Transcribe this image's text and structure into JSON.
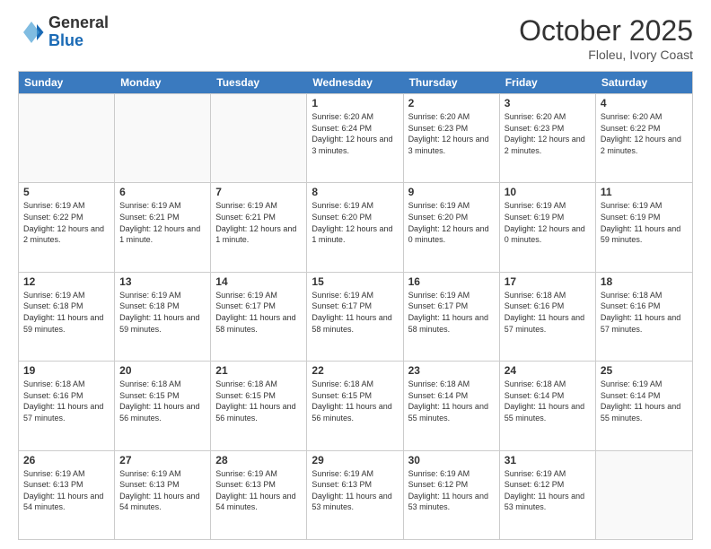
{
  "header": {
    "logo_general": "General",
    "logo_blue": "Blue",
    "month_title": "October 2025",
    "location": "Floleu, Ivory Coast"
  },
  "calendar": {
    "days_of_week": [
      "Sunday",
      "Monday",
      "Tuesday",
      "Wednesday",
      "Thursday",
      "Friday",
      "Saturday"
    ],
    "weeks": [
      [
        {
          "day": "",
          "info": "",
          "empty": true
        },
        {
          "day": "",
          "info": "",
          "empty": true
        },
        {
          "day": "",
          "info": "",
          "empty": true
        },
        {
          "day": "1",
          "info": "Sunrise: 6:20 AM\nSunset: 6:24 PM\nDaylight: 12 hours and 3 minutes."
        },
        {
          "day": "2",
          "info": "Sunrise: 6:20 AM\nSunset: 6:23 PM\nDaylight: 12 hours and 3 minutes."
        },
        {
          "day": "3",
          "info": "Sunrise: 6:20 AM\nSunset: 6:23 PM\nDaylight: 12 hours and 2 minutes."
        },
        {
          "day": "4",
          "info": "Sunrise: 6:20 AM\nSunset: 6:22 PM\nDaylight: 12 hours and 2 minutes."
        }
      ],
      [
        {
          "day": "5",
          "info": "Sunrise: 6:19 AM\nSunset: 6:22 PM\nDaylight: 12 hours and 2 minutes."
        },
        {
          "day": "6",
          "info": "Sunrise: 6:19 AM\nSunset: 6:21 PM\nDaylight: 12 hours and 1 minute."
        },
        {
          "day": "7",
          "info": "Sunrise: 6:19 AM\nSunset: 6:21 PM\nDaylight: 12 hours and 1 minute."
        },
        {
          "day": "8",
          "info": "Sunrise: 6:19 AM\nSunset: 6:20 PM\nDaylight: 12 hours and 1 minute."
        },
        {
          "day": "9",
          "info": "Sunrise: 6:19 AM\nSunset: 6:20 PM\nDaylight: 12 hours and 0 minutes."
        },
        {
          "day": "10",
          "info": "Sunrise: 6:19 AM\nSunset: 6:19 PM\nDaylight: 12 hours and 0 minutes."
        },
        {
          "day": "11",
          "info": "Sunrise: 6:19 AM\nSunset: 6:19 PM\nDaylight: 11 hours and 59 minutes."
        }
      ],
      [
        {
          "day": "12",
          "info": "Sunrise: 6:19 AM\nSunset: 6:18 PM\nDaylight: 11 hours and 59 minutes."
        },
        {
          "day": "13",
          "info": "Sunrise: 6:19 AM\nSunset: 6:18 PM\nDaylight: 11 hours and 59 minutes."
        },
        {
          "day": "14",
          "info": "Sunrise: 6:19 AM\nSunset: 6:17 PM\nDaylight: 11 hours and 58 minutes."
        },
        {
          "day": "15",
          "info": "Sunrise: 6:19 AM\nSunset: 6:17 PM\nDaylight: 11 hours and 58 minutes."
        },
        {
          "day": "16",
          "info": "Sunrise: 6:19 AM\nSunset: 6:17 PM\nDaylight: 11 hours and 58 minutes."
        },
        {
          "day": "17",
          "info": "Sunrise: 6:18 AM\nSunset: 6:16 PM\nDaylight: 11 hours and 57 minutes."
        },
        {
          "day": "18",
          "info": "Sunrise: 6:18 AM\nSunset: 6:16 PM\nDaylight: 11 hours and 57 minutes."
        }
      ],
      [
        {
          "day": "19",
          "info": "Sunrise: 6:18 AM\nSunset: 6:16 PM\nDaylight: 11 hours and 57 minutes."
        },
        {
          "day": "20",
          "info": "Sunrise: 6:18 AM\nSunset: 6:15 PM\nDaylight: 11 hours and 56 minutes."
        },
        {
          "day": "21",
          "info": "Sunrise: 6:18 AM\nSunset: 6:15 PM\nDaylight: 11 hours and 56 minutes."
        },
        {
          "day": "22",
          "info": "Sunrise: 6:18 AM\nSunset: 6:15 PM\nDaylight: 11 hours and 56 minutes."
        },
        {
          "day": "23",
          "info": "Sunrise: 6:18 AM\nSunset: 6:14 PM\nDaylight: 11 hours and 55 minutes."
        },
        {
          "day": "24",
          "info": "Sunrise: 6:18 AM\nSunset: 6:14 PM\nDaylight: 11 hours and 55 minutes."
        },
        {
          "day": "25",
          "info": "Sunrise: 6:19 AM\nSunset: 6:14 PM\nDaylight: 11 hours and 55 minutes."
        }
      ],
      [
        {
          "day": "26",
          "info": "Sunrise: 6:19 AM\nSunset: 6:13 PM\nDaylight: 11 hours and 54 minutes."
        },
        {
          "day": "27",
          "info": "Sunrise: 6:19 AM\nSunset: 6:13 PM\nDaylight: 11 hours and 54 minutes."
        },
        {
          "day": "28",
          "info": "Sunrise: 6:19 AM\nSunset: 6:13 PM\nDaylight: 11 hours and 54 minutes."
        },
        {
          "day": "29",
          "info": "Sunrise: 6:19 AM\nSunset: 6:13 PM\nDaylight: 11 hours and 53 minutes."
        },
        {
          "day": "30",
          "info": "Sunrise: 6:19 AM\nSunset: 6:12 PM\nDaylight: 11 hours and 53 minutes."
        },
        {
          "day": "31",
          "info": "Sunrise: 6:19 AM\nSunset: 6:12 PM\nDaylight: 11 hours and 53 minutes."
        },
        {
          "day": "",
          "info": "",
          "empty": true
        }
      ]
    ]
  }
}
